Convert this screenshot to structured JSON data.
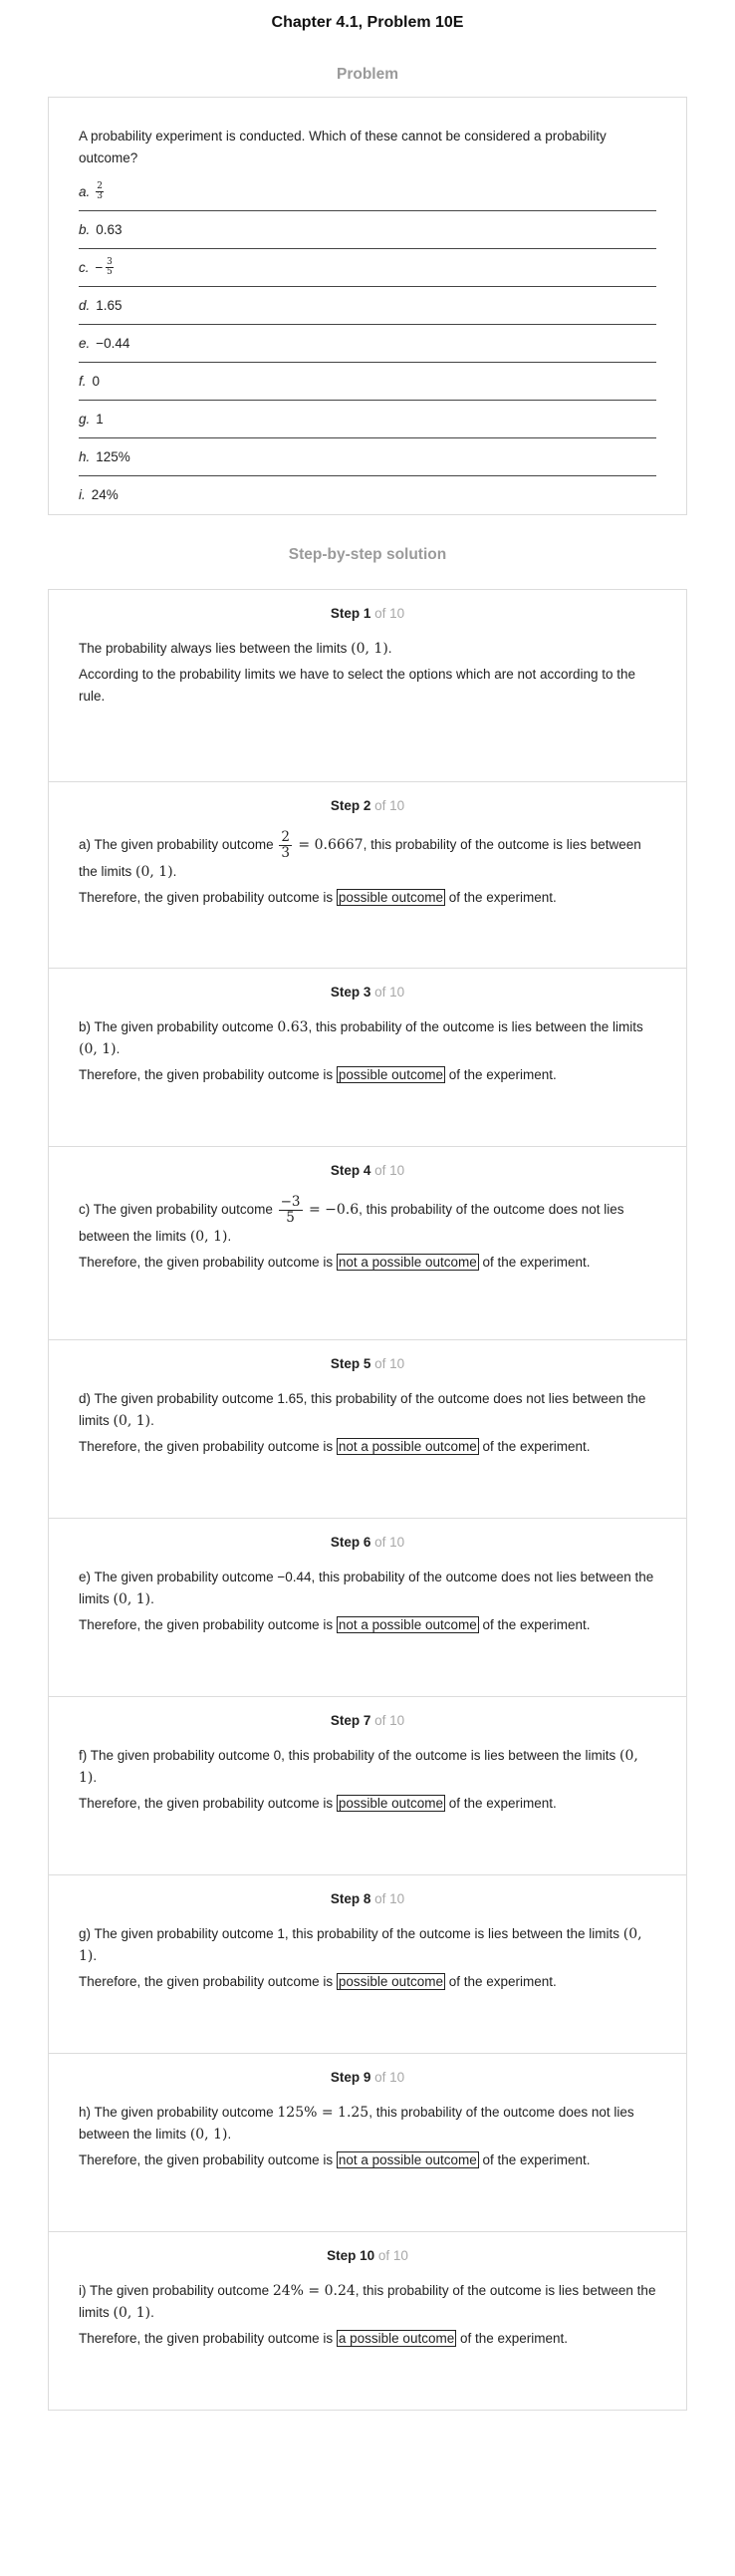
{
  "header": {
    "title": "Chapter 4.1, Problem 10E"
  },
  "problem": {
    "section_title": "Problem",
    "prompt": "A probability experiment is conducted. Which of these cannot be considered a probability outcome?",
    "options": [
      {
        "letter": "a.",
        "type": "frac",
        "sign": "",
        "num": "2",
        "den": "3"
      },
      {
        "letter": "b.",
        "type": "text",
        "text": "0.63"
      },
      {
        "letter": "c.",
        "type": "frac",
        "sign": "−",
        "num": "3",
        "den": "5"
      },
      {
        "letter": "d.",
        "type": "text",
        "text": "1.65"
      },
      {
        "letter": "e.",
        "type": "text",
        "text": "−0.44"
      },
      {
        "letter": "f.",
        "type": "text",
        "text": "0"
      },
      {
        "letter": "g.",
        "type": "text",
        "text": "1"
      },
      {
        "letter": "h.",
        "type": "text",
        "text": "125%"
      },
      {
        "letter": "i.",
        "type": "text",
        "text": "24%"
      }
    ]
  },
  "solution": {
    "section_title": "Step-by-step solution",
    "step_word": "Step",
    "of_text": "of 10",
    "limits": "(0, 1)",
    "conclusion_prefix": "Therefore, the given probability outcome is",
    "conclusion_suffix": "of the experiment.",
    "step1": {
      "number": "1",
      "line1_text": "The probability always lies between the limits",
      "line2": "According to the probability limits we have to select the options which are not according to the rule."
    },
    "steps": [
      {
        "number": "2",
        "pre": "a) The given probability outcome",
        "frac_num": "2",
        "frac_den": "3",
        "math": " = 0.6667",
        "mid": ", this probability of the outcome is lies between the limits",
        "verdict": "possible outcome"
      },
      {
        "number": "3",
        "pre": "b) The given probability outcome",
        "math": "0.63",
        "mid": ", this probability of the outcome is lies between the limits",
        "verdict": "possible outcome"
      },
      {
        "number": "4",
        "pre": "c) The given probability outcome",
        "frac_num": "−3",
        "frac_den": "5",
        "math": " = −0.6",
        "mid": ", this probability of the outcome does not lies between the limits",
        "verdict": "not a possible outcome"
      },
      {
        "number": "5",
        "pre": "d) The given probability outcome 1.65, this probability of the outcome does not lies between the limits",
        "verdict": "not a possible outcome"
      },
      {
        "number": "6",
        "pre": "e) The given probability outcome −0.44, this probability of the outcome does not lies between the limits",
        "verdict": "not a possible outcome"
      },
      {
        "number": "7",
        "pre": "f) The given probability outcome 0, this probability of the outcome is lies between the limits",
        "verdict": "possible outcome"
      },
      {
        "number": "8",
        "pre": "g) The given probability outcome 1, this probability of the outcome is lies between the limits",
        "verdict": "possible outcome"
      },
      {
        "number": "9",
        "pre": "h) The given probability outcome",
        "math": "125% = 1.25",
        "mid": ", this probability of the outcome does not lies between the limits",
        "verdict": "not a possible outcome"
      },
      {
        "number": "10",
        "pre": "i) The given probability outcome",
        "math": "24% = 0.24",
        "mid": ", this probability of the outcome is lies between the limits",
        "verdict": "a possible outcome"
      }
    ]
  }
}
